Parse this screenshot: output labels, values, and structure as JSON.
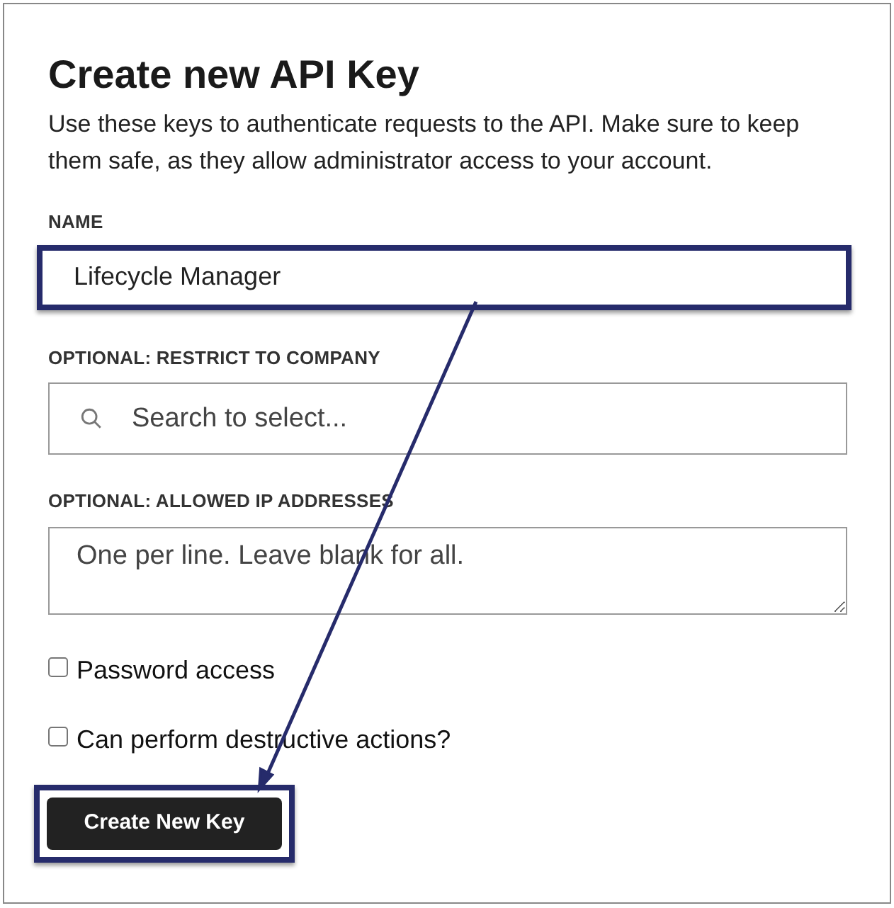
{
  "title": "Create new API Key",
  "description": "Use these keys to authenticate requests to the API. Make sure to keep them safe, as they allow administrator access to your account.",
  "name_field": {
    "label": "NAME",
    "value": "Lifecycle Manager"
  },
  "company_field": {
    "label": "OPTIONAL: RESTRICT TO COMPANY",
    "placeholder": "Search to select..."
  },
  "ip_field": {
    "label": "OPTIONAL: ALLOWED IP ADDRESSES",
    "placeholder": "One per line. Leave blank for all."
  },
  "checkboxes": [
    {
      "label": "Password access",
      "checked": false
    },
    {
      "label": "Can perform destructive actions?",
      "checked": false
    }
  ],
  "button": "Create New Key"
}
